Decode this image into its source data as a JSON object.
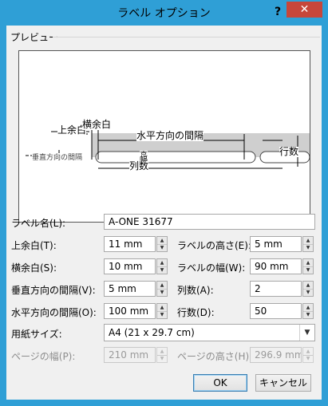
{
  "window": {
    "title": "ラベル オプション",
    "help_label": "?",
    "close_label": "✕"
  },
  "preview": {
    "label": "プレビュー",
    "annotations": {
      "top_margin": "上余白",
      "side_margin": "横余白",
      "horizontal_pitch": "水平方向の間隔",
      "rows": "行数",
      "label_height": "高",
      "label_width": "幅",
      "columns": "列数",
      "vertical_pitch": "垂直方向の間隔"
    }
  },
  "fields": {
    "label_name": {
      "label": "ラベル名(L):",
      "value": "A-ONE 31677"
    },
    "top_margin": {
      "label": "上余白(T):",
      "value": "11 mm"
    },
    "label_height": {
      "label": "ラベルの高さ(E):",
      "value": "5 mm"
    },
    "side_margin": {
      "label": "横余白(S):",
      "value": "10 mm"
    },
    "label_width": {
      "label": "ラベルの幅(W):",
      "value": "90 mm"
    },
    "vertical_pitch": {
      "label": "垂直方向の間隔(V):",
      "value": "5 mm"
    },
    "columns": {
      "label": "列数(A):",
      "value": "2"
    },
    "horizontal_pitch": {
      "label": "水平方向の間隔(O):",
      "value": "100 mm"
    },
    "rows": {
      "label": "行数(D):",
      "value": "50"
    },
    "page_size": {
      "label": "用紙サイズ:",
      "value": "A4 (21 x 29.7 cm)"
    },
    "page_width": {
      "label": "ページの幅(P):",
      "value": "210 mm"
    },
    "page_height": {
      "label": "ページの高さ(H):",
      "value": "296.9 mm"
    }
  },
  "buttons": {
    "ok": "OK",
    "cancel": "キャンセル"
  },
  "icons": {
    "spin_up": "▲",
    "spin_down": "▼",
    "dropdown": "▼"
  }
}
